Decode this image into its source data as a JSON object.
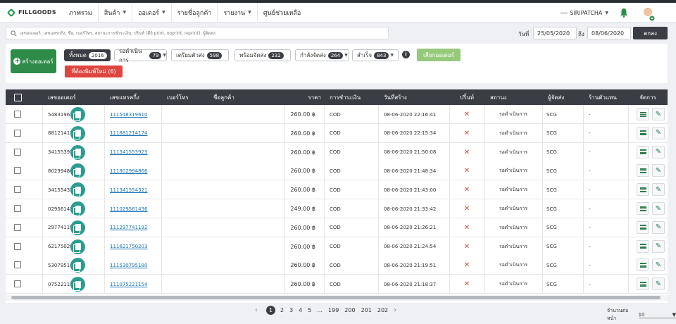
{
  "brand": {
    "name": "FILLGOODS"
  },
  "nav": {
    "items": [
      {
        "label": "ภาพรวม",
        "dropdown": false
      },
      {
        "label": "สินค้า",
        "dropdown": true
      },
      {
        "label": "ออเดอร์",
        "dropdown": true
      },
      {
        "label": "รายชื่อลูกค้า",
        "dropdown": false
      },
      {
        "label": "รายงาน",
        "dropdown": true
      },
      {
        "label": "ศูนย์ช่วยเหลือ",
        "dropdown": false
      }
    ],
    "user": "SIRIPATCHA"
  },
  "search": {
    "placeholder": "เลขออเดอร์, เลขแทรกกิ้ง, ชื่อ, เบอร์โทร, สถานะการชำระเงิน, ปริ้นท์ (คีย์ print, noprint, reprint), ผู้จัดส่ง",
    "from_label": "วันที่",
    "from_value": "25/05/2020",
    "to_label": "ถึง",
    "to_value": "08/06/2020",
    "submit": "ตกลง"
  },
  "actions": {
    "create_order": "สร้างออเดอร์",
    "select_orders": "เลือกออเดอร์",
    "reprint": "ที่ต้องพิมพ์ใหม่ (6)"
  },
  "filters": [
    {
      "label": "ทั้งหมด",
      "count": "2016",
      "active": true,
      "dropdown": false
    },
    {
      "label": "รอดำเนินการ",
      "count": "79",
      "active": false,
      "dropdown": true
    },
    {
      "label": "เตรียมตัวส่ง",
      "count": "598",
      "active": false,
      "dropdown": false
    },
    {
      "label": "พร้อมจัดส่ง",
      "count": "232",
      "active": false,
      "dropdown": false
    },
    {
      "label": "กำลังจัดส่ง",
      "count": "264",
      "active": false,
      "dropdown": true
    },
    {
      "label": "สำเร็จ",
      "count": "843",
      "active": false,
      "dropdown": true
    }
  ],
  "table": {
    "headers": [
      "เลขออเดอร์",
      "เลขแทรคกิ้ง",
      "เบอร์โทร",
      "ชื่อลูกค้า",
      "ราคา",
      "การชำระเงิน",
      "วันที่สร้าง",
      "ปริ้นท์",
      "สถานะ",
      "ผู้จัดส่ง",
      "ร้านตัวแทน",
      "จัดการ"
    ],
    "rows": [
      {
        "order": "54831961",
        "tracking": "111548319610",
        "phone": "",
        "name": "",
        "price": "260.00 ฿",
        "payment": "COD",
        "created": "08-06-2020 22:16:41",
        "printed": "✕",
        "status": "รอดำเนินการ",
        "carrier": "SCG",
        "agent": "-"
      },
      {
        "order": "88121417",
        "tracking": "111881214174",
        "phone": "",
        "name": "",
        "price": "260.00 ฿",
        "payment": "COD",
        "created": "08-06-2020 22:15:34",
        "printed": "✕",
        "status": "รอดำเนินการ",
        "carrier": "SCG",
        "agent": "-"
      },
      {
        "order": "34155392",
        "tracking": "111341553923",
        "phone": "",
        "name": "",
        "price": "260.00 ฿",
        "payment": "COD",
        "created": "08-06-2020 21:50:08",
        "printed": "✕",
        "status": "รอดำเนินการ",
        "carrier": "SCG",
        "agent": "-"
      },
      {
        "order": "80299486",
        "tracking": "111802994866",
        "phone": "",
        "name": "",
        "price": "260.00 ฿",
        "payment": "COD",
        "created": "08-06-2020 21:48:34",
        "printed": "✕",
        "status": "รอดำเนินการ",
        "carrier": "SCG",
        "agent": "-"
      },
      {
        "order": "34155432",
        "tracking": "111341554321",
        "phone": "",
        "name": "",
        "price": "260.00 ฿",
        "payment": "COD",
        "created": "08-06-2020 21:43:00",
        "printed": "✕",
        "status": "รอดำเนินการ",
        "carrier": "SCG",
        "agent": "-"
      },
      {
        "order": "02956143",
        "tracking": "111029561436",
        "phone": "",
        "name": "",
        "price": "249.00 ฿",
        "payment": "COD",
        "created": "08-06-2020 21:33:42",
        "printed": "✕",
        "status": "รอดำเนินการ",
        "carrier": "SCG",
        "agent": "-"
      },
      {
        "order": "29774119",
        "tracking": "111297741192",
        "phone": "",
        "name": "",
        "price": "260.00 ฿",
        "payment": "COD",
        "created": "08-06-2020 21:26:21",
        "printed": "✕",
        "status": "รอดำเนินการ",
        "carrier": "SCG",
        "agent": "-"
      },
      {
        "order": "62175020",
        "tracking": "111621750203",
        "phone": "",
        "name": "",
        "price": "260.00 ฿",
        "payment": "COD",
        "created": "08-06-2020 21:24:54",
        "printed": "✕",
        "status": "รอดำเนินการ",
        "carrier": "SCG",
        "agent": "-"
      },
      {
        "order": "53079518",
        "tracking": "111530795180",
        "phone": "",
        "name": "",
        "price": "260.00 ฿",
        "payment": "COD",
        "created": "08-06-2020 21:19:51",
        "printed": "✕",
        "status": "รอดำเนินการ",
        "carrier": "SCG",
        "agent": "-"
      },
      {
        "order": "07522115",
        "tracking": "111075221154",
        "phone": "",
        "name": "",
        "price": "260.00 ฿",
        "payment": "COD",
        "created": "08-06-2020 21:18:37",
        "printed": "✕",
        "status": "รอดำเนินการ",
        "carrier": "SCG",
        "agent": "-"
      }
    ]
  },
  "pagination": {
    "prev": "‹",
    "current": "1",
    "pages": [
      "2",
      "3",
      "4",
      "5",
      "...",
      "199",
      "200",
      "201",
      "202"
    ],
    "next": "›",
    "per_page_label": "จำนวนต่อหน้า",
    "per_page_value": "10"
  },
  "icons": {
    "search": "search-icon",
    "bell": "bell-icon",
    "avatar": "avatar-icon",
    "document": "copy-icon",
    "list": "list-icon",
    "edit": "pencil-icon",
    "info": "info-icon",
    "plus": "plus-circle-icon"
  },
  "colors": {
    "brand_green": "#2e8b4a",
    "header_dark": "#3a3d44",
    "teal": "#2a9d8f",
    "danger": "#e0443e",
    "link": "#1a73b8",
    "light_green": "#97c97c"
  }
}
